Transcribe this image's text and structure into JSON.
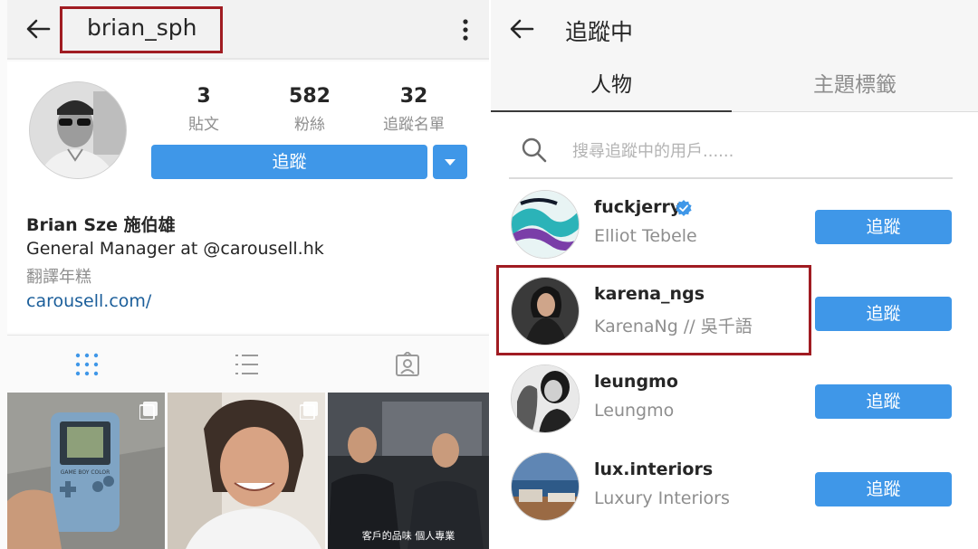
{
  "left": {
    "username": "brian_sph",
    "stats": [
      {
        "value": "3",
        "label": "貼文"
      },
      {
        "value": "582",
        "label": "粉絲"
      },
      {
        "value": "32",
        "label": "追蹤名單"
      }
    ],
    "follow_label": "追蹤",
    "bio": {
      "name": "Brian Sze 施伯雄",
      "line": "General Manager at @carousell.hk",
      "category": "翻譯年糕",
      "link": "carousell.com/"
    },
    "tabs": [
      {
        "icon": "grid-icon"
      },
      {
        "icon": "list-icon"
      },
      {
        "icon": "tagged-icon"
      }
    ],
    "photos": [
      {
        "alt": "gameboy-photo",
        "overlay": "GAME BOY COLOR"
      },
      {
        "alt": "woman-portrait-photo"
      },
      {
        "alt": "tv-interview-photo",
        "caption": "客戶的品味 個人專業"
      }
    ]
  },
  "right": {
    "title": "追蹤中",
    "tabs": {
      "people": "人物",
      "hashtags": "主題標籤"
    },
    "search_placeholder": "搜尋追蹤中的用戶......",
    "follow_label": "追蹤",
    "following": [
      {
        "username": "fuckjerry",
        "name": "Elliot Tebele",
        "verified": true
      },
      {
        "username": "karena_ngs",
        "name": "KarenaNg // 吳千語",
        "verified": false
      },
      {
        "username": "leungmo",
        "name": "Leungmo",
        "verified": false
      },
      {
        "username": "lux.interiors",
        "name": "Luxury Interiors",
        "verified": false
      }
    ]
  },
  "colors": {
    "accent": "#3f97e8",
    "highlight": "#a01c22",
    "muted": "#8e8e8e",
    "link": "#1b5e9a"
  }
}
